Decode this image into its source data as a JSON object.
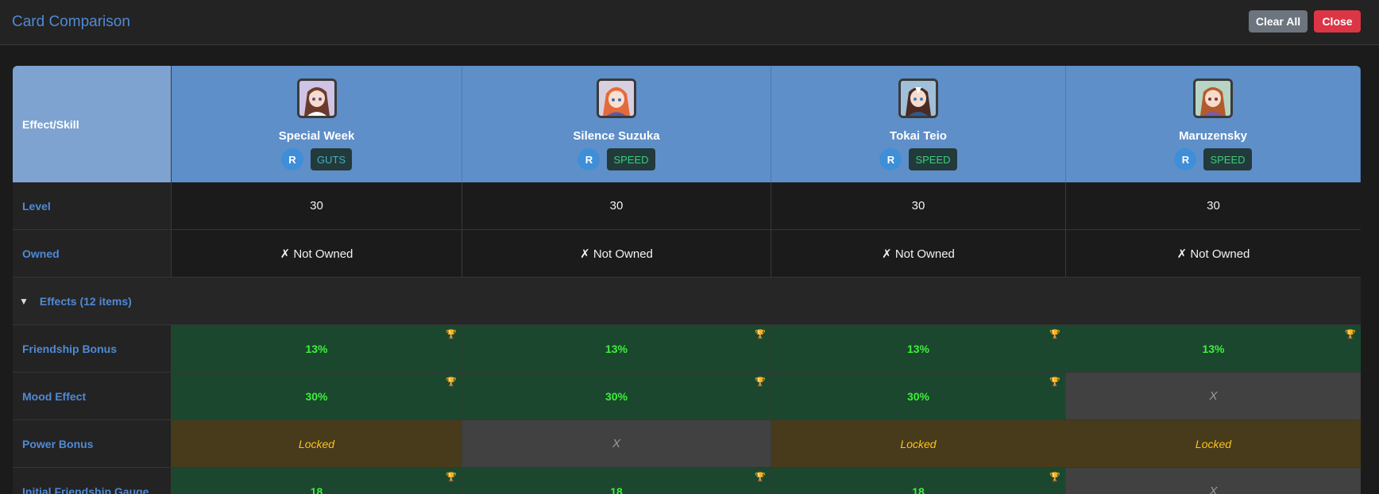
{
  "header": {
    "title": "Card Comparison",
    "clear_label": "Clear All",
    "close_label": "Close"
  },
  "table": {
    "corner_label": "Effect/Skill",
    "cards": [
      {
        "name": "Special Week",
        "rarity": "R",
        "type": "GUTS",
        "type_color": "#3fb0c5",
        "avatar": "special-week-portrait"
      },
      {
        "name": "Silence Suzuka",
        "rarity": "R",
        "type": "SPEED",
        "type_color": "#36d07a",
        "avatar": "silence-suzuka-portrait"
      },
      {
        "name": "Tokai Teio",
        "rarity": "R",
        "type": "SPEED",
        "type_color": "#36d07a",
        "avatar": "tokai-teio-portrait"
      },
      {
        "name": "Maruzensky",
        "rarity": "R",
        "type": "SPEED",
        "type_color": "#36d07a",
        "avatar": "maruzensky-portrait"
      }
    ],
    "level": {
      "label": "Level",
      "values": [
        "30",
        "30",
        "30",
        "30"
      ]
    },
    "owned": {
      "label": "Owned",
      "values": [
        "✗ Not Owned",
        "✗ Not Owned",
        "✗ Not Owned",
        "✗ Not Owned"
      ]
    },
    "effects_section": {
      "label": "Effects (12 items)",
      "expanded": true
    },
    "effects": [
      {
        "label": "Friendship Bonus",
        "values": [
          "13%",
          "13%",
          "13%",
          "13%"
        ],
        "states": [
          "max",
          "max",
          "max",
          "max"
        ]
      },
      {
        "label": "Mood Effect",
        "values": [
          "30%",
          "30%",
          "30%",
          "X"
        ],
        "states": [
          "max",
          "max",
          "max",
          "none"
        ]
      },
      {
        "label": "Power Bonus",
        "values": [
          "Locked",
          "X",
          "Locked",
          "Locked"
        ],
        "states": [
          "locked",
          "none",
          "locked",
          "locked"
        ]
      },
      {
        "label": "Initial Friendship Gauge",
        "values": [
          "18",
          "18",
          "18",
          "X"
        ],
        "states": [
          "max",
          "max",
          "max",
          "none"
        ]
      }
    ]
  },
  "colors": {
    "accent": "#4f8ad6",
    "header_bg": "#5e8fc8",
    "max_bg": "#1b472e",
    "locked_bg": "#473b1c",
    "none_bg": "#414141",
    "clear_btn": "#6c757d",
    "close_btn": "#dc3545"
  }
}
